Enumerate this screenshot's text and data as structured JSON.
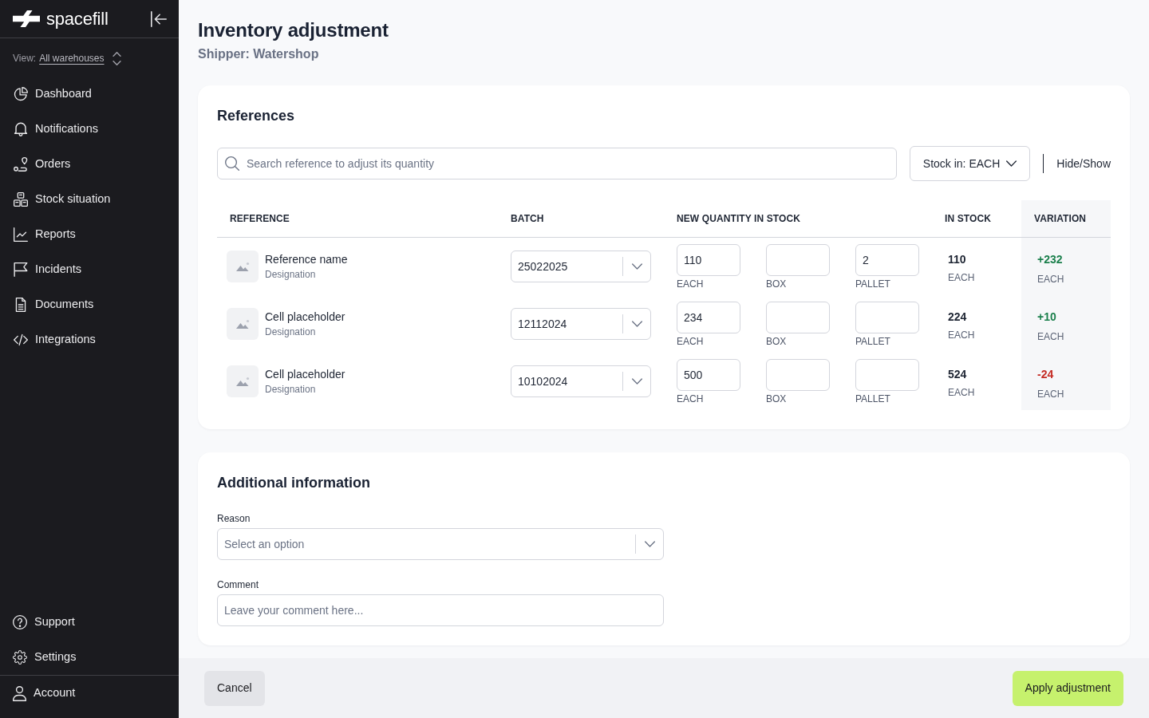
{
  "sidebar": {
    "brand": "spacefill",
    "view": {
      "label": "View:",
      "value": "All warehouses"
    },
    "nav": [
      {
        "label": "Dashboard"
      },
      {
        "label": "Notifications"
      },
      {
        "label": "Orders"
      },
      {
        "label": "Stock situation"
      },
      {
        "label": "Reports"
      },
      {
        "label": "Incidents"
      },
      {
        "label": "Documents"
      },
      {
        "label": "Integrations"
      }
    ],
    "footer_nav": [
      {
        "label": "Support"
      },
      {
        "label": "Settings"
      }
    ],
    "account": {
      "label": "Account"
    }
  },
  "page": {
    "title": "Inventory adjustment",
    "subtitle": "Shipper: Watershop"
  },
  "references": {
    "title": "References",
    "search": {
      "placeholder": "Search reference to adjust its quantity"
    },
    "stock_unit_button": "Stock in: EACH",
    "hide_show_button": "Hide/Show",
    "columns": [
      "REFERENCE",
      "BATCH",
      "NEW QUANTITY IN STOCK",
      "IN STOCK",
      "VARIATION"
    ],
    "rows": [
      {
        "name": "Reference name",
        "designation": "Designation",
        "batch": "25022025",
        "quantities": [
          {
            "value": "110",
            "unit": "EACH"
          },
          {
            "unit": "BOX"
          },
          {
            "value": "2",
            "unit": "PALLET"
          }
        ],
        "in_stock": {
          "value": "110",
          "unit": "EACH"
        },
        "variation": {
          "value": "+232",
          "unit": "EACH",
          "color": "#1a7f4b"
        }
      },
      {
        "name": "Cell placeholder",
        "designation": "Designation",
        "batch": "12112024",
        "quantities": [
          {
            "value": "234",
            "unit": "EACH"
          },
          {
            "unit": "BOX"
          },
          {
            "unit": "PALLET"
          }
        ],
        "in_stock": {
          "value": "224",
          "unit": "EACH"
        },
        "variation": {
          "value": "+10",
          "unit": "EACH",
          "color": "#1a7f4b"
        }
      },
      {
        "name": "Cell placeholder",
        "designation": "Designation",
        "batch": "10102024",
        "quantities": [
          {
            "value": "500",
            "unit": "EACH"
          },
          {
            "unit": "BOX"
          },
          {
            "unit": "PALLET"
          }
        ],
        "in_stock": {
          "value": "524",
          "unit": "EACH"
        },
        "variation": {
          "value": "-24",
          "unit": "EACH",
          "color": "#c42b24"
        }
      }
    ]
  },
  "additional_information": {
    "title": "Additional information",
    "fields": [
      {
        "kind": "select",
        "label": "Reason",
        "placeholder": "Select an option"
      },
      {
        "kind": "text",
        "label": "Comment",
        "placeholder": "Leave your comment here..."
      }
    ]
  },
  "footer": {
    "cancel_button": "Cancel",
    "apply_button": "Apply adjustment"
  }
}
